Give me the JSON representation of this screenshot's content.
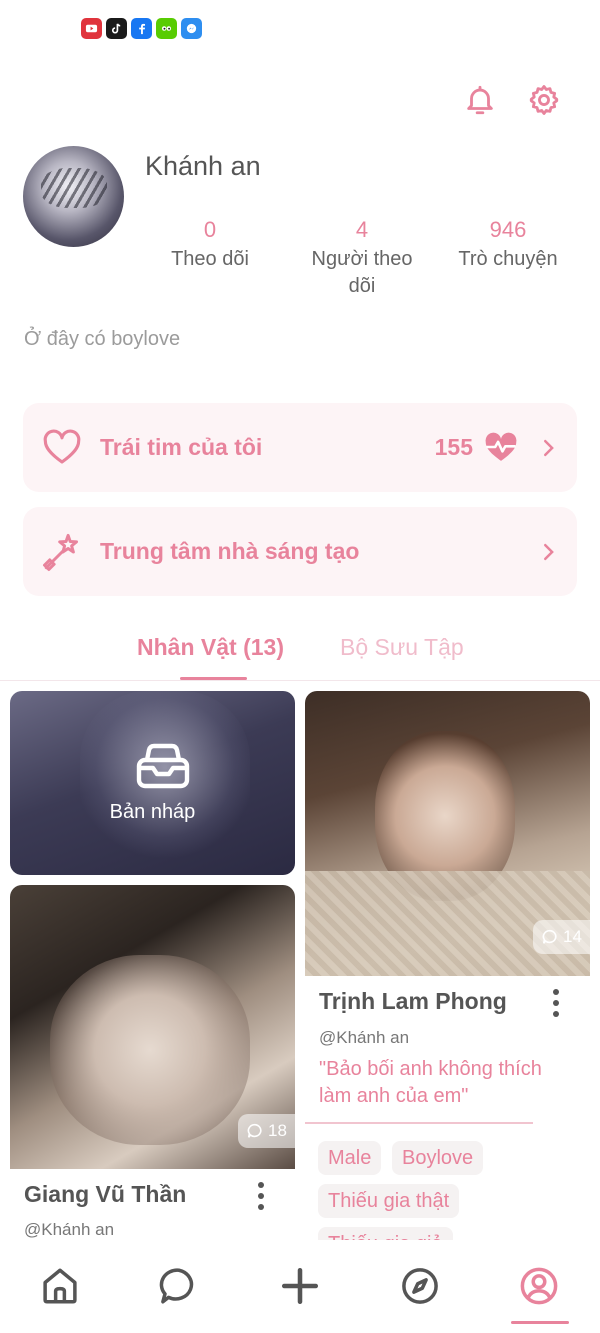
{
  "status_bar": {
    "app_icons": [
      "youtube-icon",
      "tiktok-icon",
      "facebook-icon",
      "duolingo-icon",
      "messenger-icon"
    ]
  },
  "header": {
    "actions": [
      "bell-icon",
      "gear-icon"
    ]
  },
  "profile": {
    "username": "Khánh an",
    "stats": [
      {
        "value": "0",
        "label": "Theo dõi"
      },
      {
        "value": "4",
        "label": "Người theo dõi"
      },
      {
        "value": "946",
        "label": "Trò chuyện"
      }
    ],
    "bio": "Ở đây có boylove"
  },
  "menu": {
    "hearts": {
      "label": "Trái tim của tôi",
      "value": "155"
    },
    "creator": {
      "label": "Trung tâm nhà sáng tạo"
    }
  },
  "tabs": {
    "characters": "Nhân Vật (13)",
    "collection": "Bộ Sưu Tập"
  },
  "grid": {
    "draft_label": "Bản nháp",
    "cards": [
      {
        "name": "Giang Vũ Thần",
        "author": "@Khánh an",
        "count": "18"
      },
      {
        "name": "Trịnh Lam Phong",
        "author": "@Khánh an",
        "count": "14",
        "quote": "\"Bảo bối anh không thích làm anh của em\"",
        "tags": [
          "Male",
          "Boylove",
          "Thiếu gia thật",
          "Thiếu gia giả"
        ]
      }
    ]
  },
  "bottom_nav": [
    "home-icon",
    "chat-icon",
    "add-icon",
    "explore-icon",
    "profile-icon"
  ],
  "colors": {
    "accent": "#e8839c",
    "card_bg": "#fdf4f6",
    "tag_bg": "#f5f2f2",
    "text": "#555555"
  }
}
